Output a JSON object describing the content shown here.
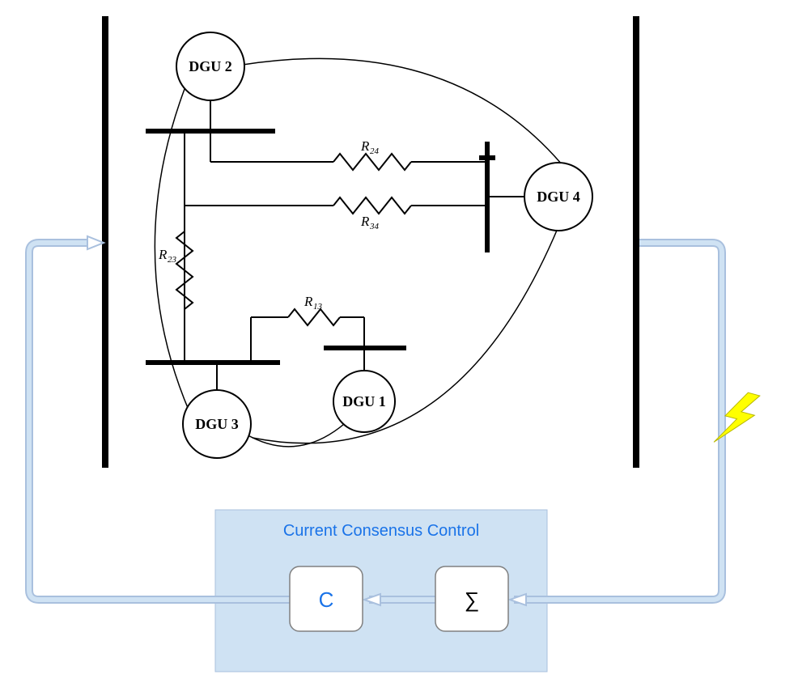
{
  "nodes": {
    "dgu1": "DGU 1",
    "dgu2": "DGU 2",
    "dgu3": "DGU 3",
    "dgu4": "DGU 4"
  },
  "resistors": {
    "r24": {
      "R": "R",
      "sub": "24"
    },
    "r34": {
      "R": "R",
      "sub": "34"
    },
    "r23": {
      "R": "R",
      "sub": "23"
    },
    "r13": {
      "R": "R",
      "sub": "13"
    }
  },
  "control": {
    "title": "Current Consensus Control",
    "block_c": "C",
    "block_sum": "∑"
  }
}
